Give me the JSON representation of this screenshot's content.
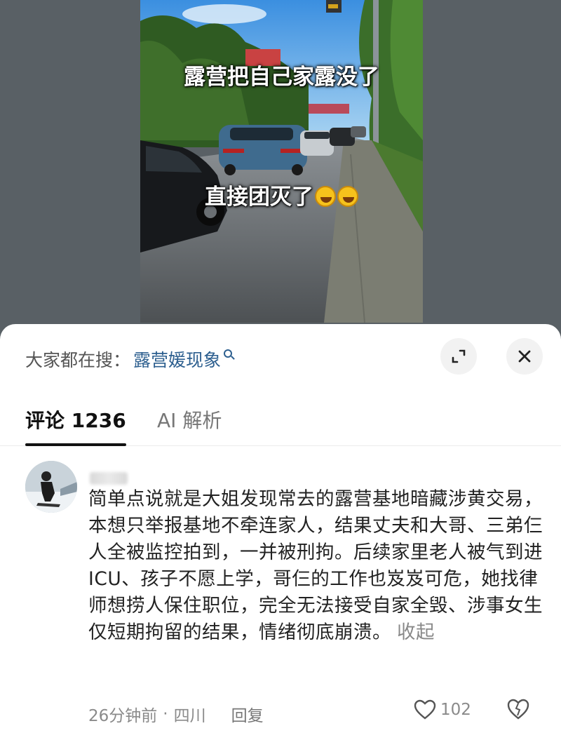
{
  "video": {
    "caption_top": "露营把自己家露没了",
    "caption_mid": "直接团灭了",
    "emoji": [
      "rolling-laughing-emoji",
      "rolling-laughing-emoji"
    ]
  },
  "sheet": {
    "search_label": "大家都在搜：",
    "search_term": "露营媛现象",
    "icons": {
      "search": "search-icon",
      "expand": "expand-icon",
      "close": "close-icon"
    }
  },
  "tabs": [
    {
      "label": "评论 1236",
      "active": true
    },
    {
      "label": "AI 解析",
      "active": false
    }
  ],
  "comment": {
    "text": "简单点说就是大姐发现常去的露营基地暗藏涉黄交易，本想只举报基地不牵连家人，结果丈夫和大哥、三弟仨人全被监控拍到，一并被刑拘。后续家里老人被气到进ICU、孩子不愿上学，哥仨的工作也岌岌可危，她找律师想捞人保住职位，完全无法接受自家全毁、涉事女生仅短期拘留的结果，情绪彻底崩溃。",
    "collapse_label": "收起",
    "time": "26分钟前",
    "separator": "·",
    "location": "四川",
    "reply_label": "回复",
    "like_count": "102"
  },
  "colors": {
    "backdrop": "#596065",
    "link_blue": "#2d5f8f",
    "text_dark": "#222222",
    "text_muted": "#8a8a8a"
  }
}
